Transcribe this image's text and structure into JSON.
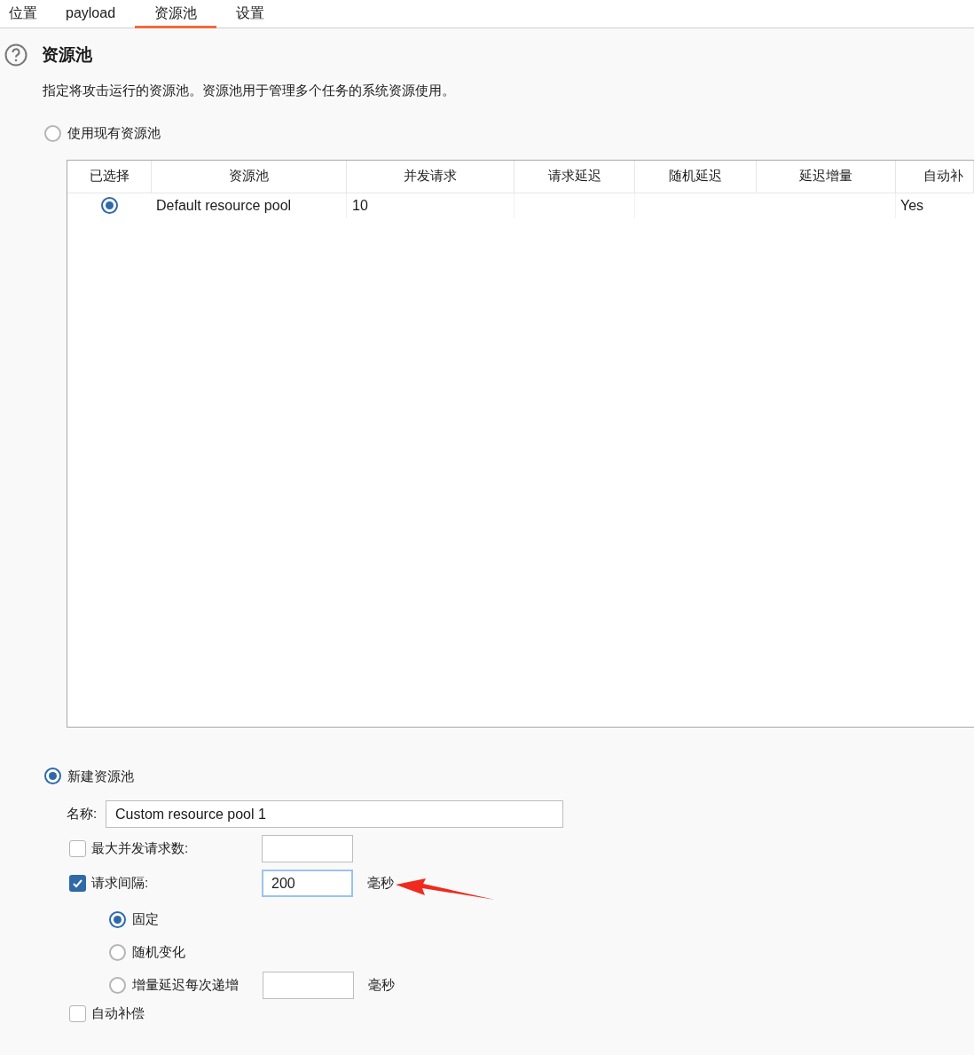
{
  "tabs": [
    {
      "label": "位置",
      "selected": false
    },
    {
      "label": "payload",
      "selected": false
    },
    {
      "label": "资源池",
      "selected": true
    },
    {
      "label": "设置",
      "selected": false
    }
  ],
  "section": {
    "title": "资源池",
    "description": "指定将攻击运行的资源池。资源池用于管理多个任务的系统资源使用。"
  },
  "use_existing": {
    "label": "使用现有资源池",
    "selected": false
  },
  "table": {
    "columns": [
      "已选择",
      "资源池",
      "并发请求",
      "请求延迟",
      "随机延迟",
      "延迟增量",
      "自动补"
    ],
    "rows": [
      {
        "selected": true,
        "resource_pool": "Default resource pool",
        "concurrent_requests": "10",
        "auto_compensation": "Yes"
      }
    ]
  },
  "create_new": {
    "label": "新建资源池",
    "selected": true
  },
  "name_field": {
    "label": "名称:",
    "value": "Custom resource pool 1"
  },
  "max_concurrent": {
    "label": "最大并发请求数:",
    "checked": false
  },
  "request_interval": {
    "label": "请求间隔:",
    "checked": true,
    "value": "200",
    "unit": "毫秒"
  },
  "interval_modes": [
    {
      "label": "固定",
      "selected": true
    },
    {
      "label": "随机变化",
      "selected": false
    },
    {
      "label": "增量延迟每次递增",
      "selected": false,
      "unit": "毫秒"
    }
  ],
  "auto_compensate": {
    "label": "自动补偿",
    "checked": false
  }
}
